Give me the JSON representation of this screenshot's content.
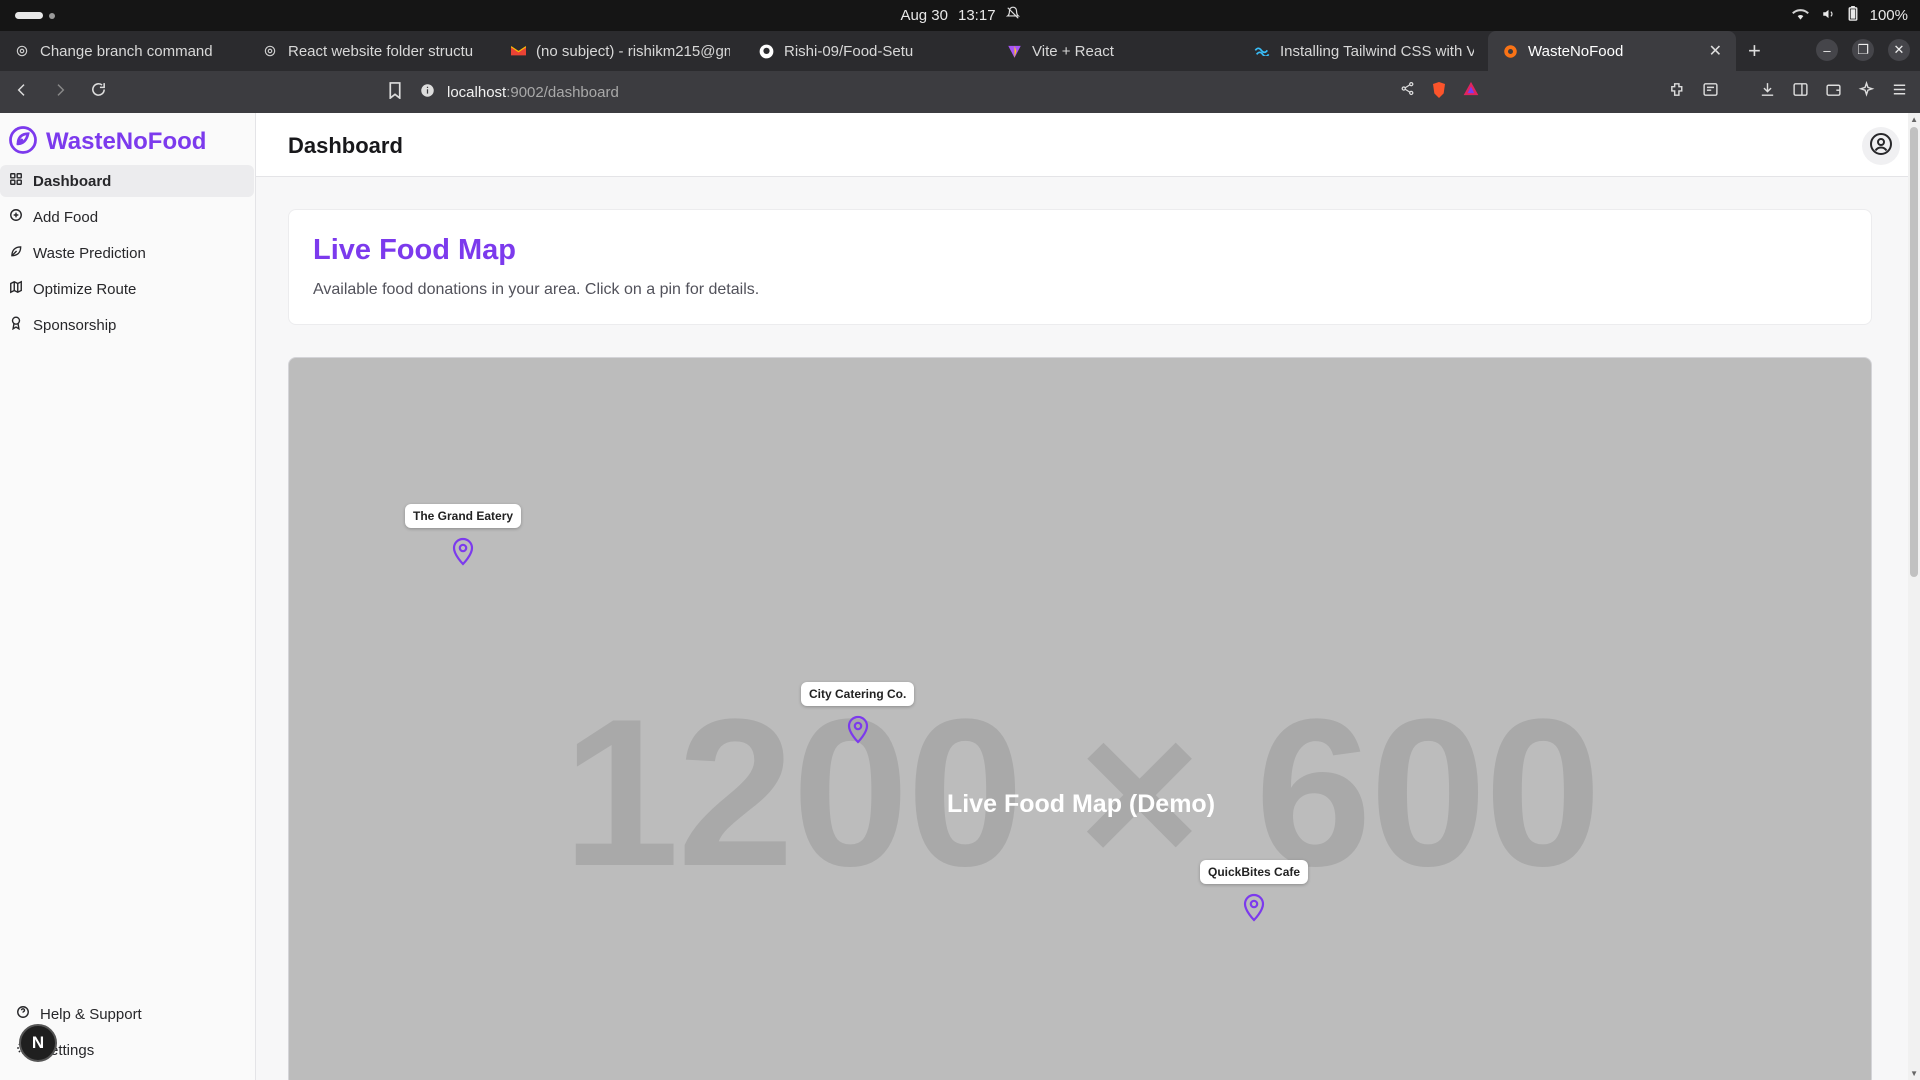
{
  "os": {
    "date": "Aug 30",
    "time": "13:17",
    "battery": "100%"
  },
  "tabs": [
    {
      "title": "Change branch command",
      "icon": "openai-icon"
    },
    {
      "title": "React website folder structu",
      "icon": "openai-icon"
    },
    {
      "title": "(no subject) - rishikm215@gm",
      "icon": "gmail-icon"
    },
    {
      "title": "Rishi-09/Food-Setu",
      "icon": "github-icon"
    },
    {
      "title": "Vite + React",
      "icon": "vite-icon"
    },
    {
      "title": "Installing Tailwind CSS with V",
      "icon": "tailwind-icon"
    },
    {
      "title": "WasteNoFood",
      "icon": "app-icon"
    }
  ],
  "address": {
    "host": "localhost",
    "path": ":9002/dashboard"
  },
  "sidebar": {
    "brand": "WasteNoFood",
    "items": [
      {
        "label": "Dashboard",
        "icon": "grid-icon"
      },
      {
        "label": "Add Food",
        "icon": "plus-circle-icon"
      },
      {
        "label": "Waste Prediction",
        "icon": "leaf-icon"
      },
      {
        "label": "Optimize Route",
        "icon": "map-icon"
      },
      {
        "label": "Sponsorship",
        "icon": "award-icon"
      }
    ],
    "bottom": [
      {
        "label": "Help & Support",
        "icon": "help-icon"
      },
      {
        "label": "Settings",
        "icon": "gear-icon"
      }
    ],
    "avatar_letter": "N"
  },
  "header": {
    "title": "Dashboard"
  },
  "intro": {
    "title": "Live Food Map",
    "subtitle": "Available food donations in your area. Click on a pin for details."
  },
  "map": {
    "placeholder": "1200 × 600",
    "label": "Live Food Map (Demo)",
    "pins": [
      {
        "name": "The Grand Eatery"
      },
      {
        "name": "City Catering Co."
      },
      {
        "name": "QuickBites Cafe"
      }
    ]
  },
  "colors": {
    "accent": "#7c3aed",
    "map_bg": "#bcbcbc"
  }
}
